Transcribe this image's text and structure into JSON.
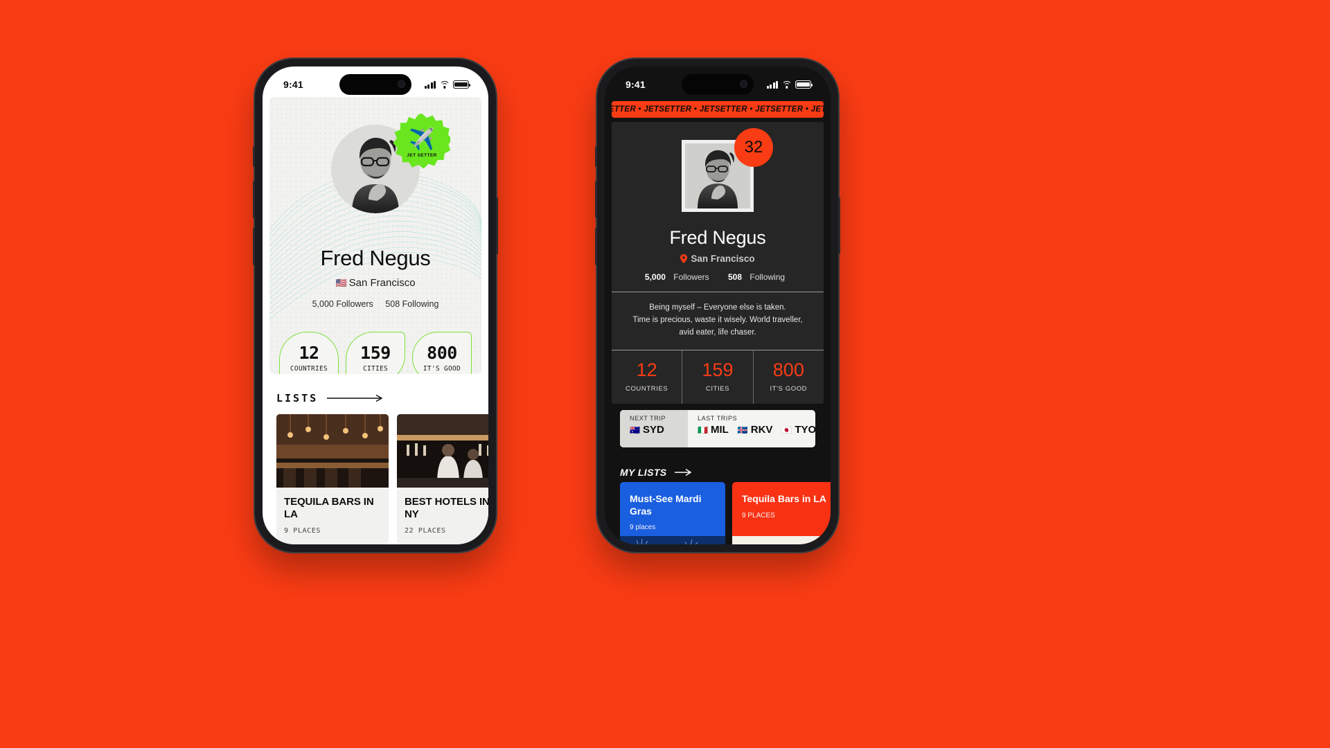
{
  "background_color": "#fa3c14",
  "phone_light": {
    "status_bar": {
      "time": "9:41"
    },
    "badge": {
      "icon": "airplane-icon",
      "label": "JET SETTER",
      "color": "#69e61e"
    },
    "profile": {
      "name": "Fred Negus",
      "location_flag": "🇺🇸",
      "location": "San Francisco",
      "followers": "5,000 Followers",
      "following": "508 Following"
    },
    "stats": [
      {
        "value": "12",
        "label": "COUNTRIES"
      },
      {
        "value": "159",
        "label": "CITIES"
      },
      {
        "value": "800",
        "label": "IT'S GOOD"
      }
    ],
    "lists_header": "LISTS",
    "lists": [
      {
        "title": "TEQUILA BARS IN LA",
        "places": "9 PLACES"
      },
      {
        "title": "BEST HOTELS IN NY",
        "places": "22 PLACES"
      }
    ]
  },
  "phone_dark": {
    "status_bar": {
      "time": "9:41"
    },
    "ticker": "JETSETTER • JETSETTER • JETSETTER • JETSETTER • JETSETT",
    "badge_count": "32",
    "profile": {
      "name": "Fred Negus",
      "location": "San Francisco",
      "followers_value": "5,000",
      "followers_label": "Followers",
      "following_value": "508",
      "following_label": "Following",
      "bio": "Being myself – Everyone else is taken.\nTime is precious, waste it wisely. World traveller,\navid eater, life chaser."
    },
    "stats": [
      {
        "value": "12",
        "label": "COUNTRIES"
      },
      {
        "value": "159",
        "label": "CITIES"
      },
      {
        "value": "800",
        "label": "IT'S GOOD"
      }
    ],
    "trips": {
      "next_label": "NEXT TRIP",
      "next": {
        "flag": "🇦🇺",
        "code": "SYD"
      },
      "last_label": "LAST TRIPS",
      "last": [
        {
          "flag": "🇮🇹",
          "code": "MIL"
        },
        {
          "flag": "🇮🇸",
          "code": "RKV"
        },
        {
          "flag": "🇯🇵",
          "code": "TYO"
        }
      ]
    },
    "lists_header": "MY LISTS",
    "lists": [
      {
        "title": "Must-See Mardi Gras",
        "places": "9 places",
        "color": "#1a5fe0"
      },
      {
        "title": "Tequila Bars in LA",
        "places": "9 PLACES",
        "color": "#fa3214"
      }
    ]
  }
}
